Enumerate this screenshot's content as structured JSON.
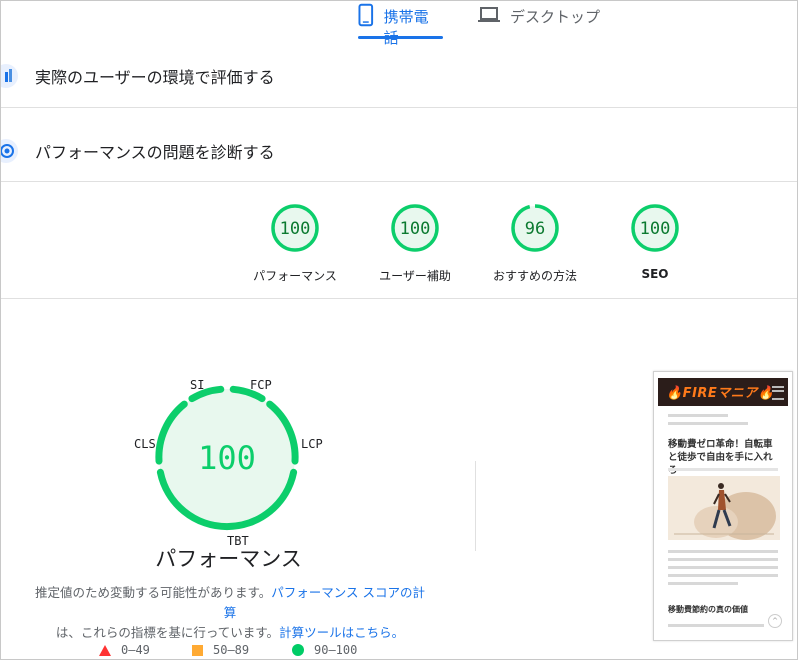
{
  "tabs": {
    "mobile": {
      "label": "携帯電話"
    },
    "desktop": {
      "label": "デスクトップ"
    }
  },
  "sections": {
    "field": {
      "title": "実際のユーザーの環境で評価する"
    },
    "lab": {
      "title": "パフォーマンスの問題を診断する"
    }
  },
  "scores": [
    {
      "label": "パフォーマンス",
      "value": "100",
      "fraction": 1.0
    },
    {
      "label": "ユーザー補助",
      "value": "100",
      "fraction": 1.0
    },
    {
      "label": "おすすめの方法",
      "value": "96",
      "fraction": 0.96
    },
    {
      "label": "SEO",
      "value": "100",
      "fraction": 1.0
    }
  ],
  "performance": {
    "score": "100",
    "title": "パフォーマンス",
    "metrics": {
      "si": "SI",
      "fcp": "FCP",
      "lcp": "LCP",
      "cls": "CLS",
      "tbt": "TBT"
    },
    "desc_text1": "推定値のため変動する可能性があります。",
    "desc_link1": "パフォーマンス スコアの計算",
    "desc_text2": "は、これらの指標を基に行っています。",
    "desc_link2": "計算ツールはこちら。"
  },
  "legend": [
    {
      "range": "0–49",
      "color": "#ff3333",
      "shape": "triangle"
    },
    {
      "range": "50–89",
      "color": "#ffaa33",
      "shape": "square"
    },
    {
      "range": "90–100",
      "color": "#00cc66",
      "shape": "circle"
    }
  ],
  "colors": {
    "accent": "#1a73e8",
    "pass": "#0cce6b",
    "pass_fill": "#e8f8ee",
    "pass_text": "#0c7a30"
  },
  "screenshot": {
    "logo": "🔥FIREマニア🔥",
    "article_title": "移動費ゼロ革命！自転車と徒歩で自由を手に入れろ",
    "section_heading": "移動費節約の真の価値"
  }
}
